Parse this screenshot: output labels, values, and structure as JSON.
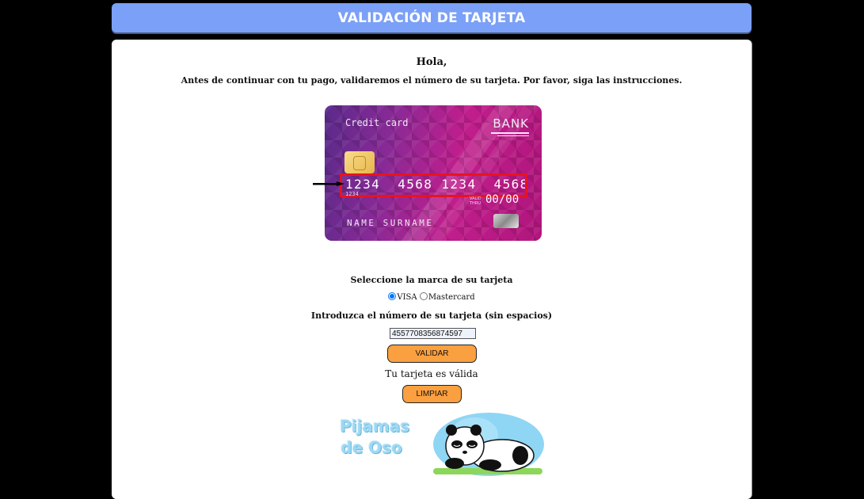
{
  "header": {
    "title": "VALIDACIÓN DE TARJETA"
  },
  "intro": {
    "greeting": "Hola,",
    "message": "Antes de continuar con tu pago, validaremos el número de su tarjeta. Por favor, siga las instrucciones."
  },
  "card_image": {
    "title": "Credit card",
    "bank": "BANK",
    "number": "1234  4568 1234  4568",
    "small_number": "1234",
    "valid_thru": "VALID\nTHRU",
    "expiry": "00/00",
    "holder": "NAME SURNAME"
  },
  "form": {
    "brand_label": "Seleccione la marca de su tarjeta",
    "brand_options": [
      "VISA",
      "Mastercard"
    ],
    "brand_selected": "VISA",
    "number_label": "Introduzca el número de su tarjeta (sin espacios)",
    "number_value": "4557708356874597",
    "validate_label": "VALIDAR",
    "result_text": "Tu tarjeta es válida",
    "clear_label": "LIMPIAR"
  },
  "logo": {
    "text": "Pijamas de Oso"
  },
  "colors": {
    "header_bg": "#7ba0f7",
    "button_bg": "#fba040",
    "highlight": "#e8131f"
  }
}
